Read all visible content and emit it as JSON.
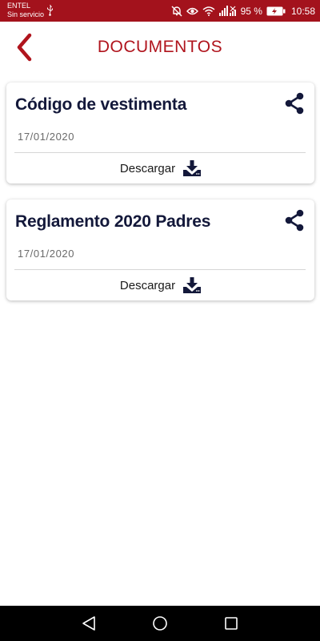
{
  "status_bar": {
    "carrier": "ENTEL",
    "service": "Sin servicio",
    "battery_percent": "95 %",
    "time": "10:58",
    "icons": [
      "usb-icon",
      "mute-icon",
      "eye-icon",
      "wifi-icon",
      "signal-icon",
      "battery-charging-icon"
    ]
  },
  "header": {
    "back_icon": "chevron-left-icon",
    "title": "DOCUMENTOS"
  },
  "documents": [
    {
      "title": "Código de vestimenta",
      "date": "17/01/2020",
      "download_label": "Descargar"
    },
    {
      "title": "Reglamento 2020 Padres",
      "date": "17/01/2020",
      "download_label": "Descargar"
    }
  ],
  "nav_bar": {
    "buttons": [
      "back-triangle-icon",
      "home-circle-icon",
      "recents-square-icon"
    ]
  },
  "colors": {
    "brand_red": "#b0141d",
    "status_bar": "#a3121c",
    "title_navy": "#13183a"
  }
}
